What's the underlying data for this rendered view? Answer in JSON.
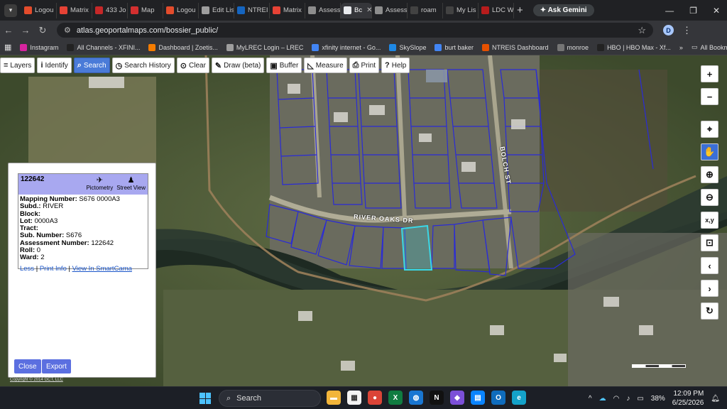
{
  "browser": {
    "tabs": [
      {
        "label": "Logou",
        "color": "#e34c2c"
      },
      {
        "label": "Matrix",
        "color": "#e64235"
      },
      {
        "label": "433 Jo",
        "color": "#c62828"
      },
      {
        "label": "Map",
        "color": "#d32f2f"
      },
      {
        "label": "Logou",
        "color": "#e34c2c"
      },
      {
        "label": "Edit Lis",
        "color": "#9e9e9e"
      },
      {
        "label": "NTREI",
        "color": "#1565c0"
      },
      {
        "label": "Matrix",
        "color": "#e64235"
      },
      {
        "label": "Assess",
        "color": "#8d8d8d"
      },
      {
        "label": "Bc",
        "color": "#e8eaed",
        "active": true
      },
      {
        "label": "Assess",
        "color": "#8d8d8d"
      },
      {
        "label": "roam",
        "color": "#424242"
      },
      {
        "label": "My Lis",
        "color": "#424242"
      },
      {
        "label": "LDC W",
        "color": "#b71c1c"
      }
    ],
    "gemini_label": "Ask Gemini",
    "url": "atlas.geoportalmaps.com/bossier_public/",
    "profile_initial": "D",
    "bookmarks": [
      {
        "label": "Instagram",
        "color": "#d6249f"
      },
      {
        "label": "All Channels - XFINI...",
        "color": "#222"
      },
      {
        "label": "Dashboard | Zoetis...",
        "color": "#f57c00"
      },
      {
        "label": "MyLREC Login – LREC",
        "color": "#9e9e9e"
      },
      {
        "label": "xfinity internet - Go...",
        "color": "#4285f4"
      },
      {
        "label": "SkySlope",
        "color": "#1e88e5"
      },
      {
        "label": "burt baker",
        "color": "#4285f4"
      },
      {
        "label": "NTREIS Dashboard",
        "color": "#e65100"
      },
      {
        "label": "monroe",
        "color": "#757575"
      },
      {
        "label": "HBO | HBO Max - Xf...",
        "color": "#222"
      }
    ],
    "all_bookmarks_label": "All Bookmarks"
  },
  "toolbar": {
    "items": [
      {
        "label": "Layers",
        "icon": "menu-icon",
        "glyph": "≡"
      },
      {
        "label": "Identify",
        "icon": "info-icon",
        "glyph": "i"
      },
      {
        "label": "Search",
        "icon": "search-icon",
        "glyph": "⌕",
        "active": true
      },
      {
        "label": "Search History",
        "icon": "clock-icon",
        "glyph": "◷"
      },
      {
        "label": "Clear",
        "icon": "clear-icon",
        "glyph": "⊙"
      },
      {
        "label": "Draw (beta)",
        "icon": "pencil-icon",
        "glyph": "✎"
      },
      {
        "label": "Buffer",
        "icon": "buffer-icon",
        "glyph": "▣"
      },
      {
        "label": "Measure",
        "icon": "ruler-icon",
        "glyph": "◺"
      },
      {
        "label": "Print",
        "icon": "printer-icon",
        "glyph": "⎙"
      },
      {
        "label": "Help",
        "icon": "help-icon",
        "glyph": "?"
      }
    ]
  },
  "map_labels": {
    "street1": "RIVER OAKS DR",
    "street2": "BOLCH ST"
  },
  "map_controls": [
    {
      "name": "zoom-in",
      "glyph": "+"
    },
    {
      "name": "zoom-out",
      "glyph": "−"
    },
    {
      "name": "locate",
      "glyph": "⌖",
      "gap": true
    },
    {
      "name": "pan",
      "glyph": "✋",
      "active": true
    },
    {
      "name": "zoom-in-box",
      "glyph": "⊕"
    },
    {
      "name": "zoom-out-box",
      "glyph": "⊖"
    },
    {
      "name": "xy",
      "glyph": "x,y"
    },
    {
      "name": "select-box",
      "glyph": "⊡"
    },
    {
      "name": "previous-extent",
      "glyph": "‹"
    },
    {
      "name": "next-extent",
      "glyph": "›"
    },
    {
      "name": "refresh",
      "glyph": "↻"
    }
  ],
  "popup": {
    "parcel_id": "122642",
    "pictometry_label": "Pictometry",
    "streetview_label": "Street View",
    "fields": [
      {
        "label": "Mapping Number:",
        "value": "S676 0000A3"
      },
      {
        "label": "Subd.:",
        "value": "RIVER"
      },
      {
        "label": "Block:",
        "value": ""
      },
      {
        "label": "Lot:",
        "value": "0000A3"
      },
      {
        "label": "Tract:",
        "value": ""
      },
      {
        "label": "Sub. Number:",
        "value": "S676"
      },
      {
        "label": "Assessment Number:",
        "value": "122642"
      },
      {
        "label": "Roll:",
        "value": "0"
      },
      {
        "label": "Ward:",
        "value": "2"
      }
    ],
    "less_label": "Less",
    "print_info_label": "Print Info",
    "smartcama_label": "View In SmartCama",
    "close_label": "Close",
    "export_label": "Export",
    "copyright": "Copyright © 2014 GCT, LLC"
  },
  "taskbar": {
    "search_placeholder": "Search",
    "apps": [
      {
        "name": "file-explorer",
        "color": "#f2b53a",
        "glyph": "▬"
      },
      {
        "name": "store",
        "color": "#f3f3f3",
        "glyph": "▦"
      },
      {
        "name": "chrome",
        "color": "#db4437",
        "glyph": "●"
      },
      {
        "name": "excel",
        "color": "#107c41",
        "glyph": "X"
      },
      {
        "name": "globe",
        "color": "#1976d2",
        "glyph": "◍"
      },
      {
        "name": "netflix",
        "color": "#111",
        "glyph": "N"
      },
      {
        "name": "drop",
        "color": "#7b4fd8",
        "glyph": "◆"
      },
      {
        "name": "news",
        "color": "#0a84ff",
        "glyph": "▤"
      },
      {
        "name": "outlook",
        "color": "#0f6cbd",
        "glyph": "O"
      },
      {
        "name": "edge",
        "color": "#14a2c9",
        "glyph": "e"
      }
    ],
    "battery": "38%",
    "time": "12:09 PM",
    "date": "6/25/2026"
  }
}
